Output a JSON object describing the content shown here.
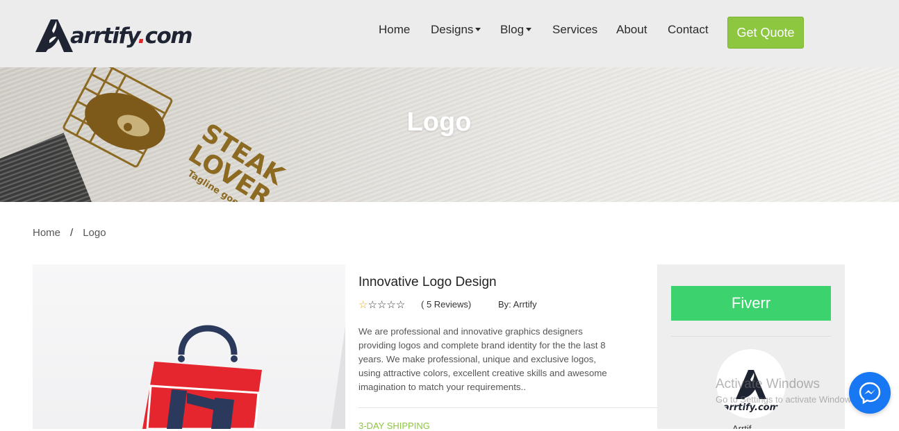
{
  "brand": {
    "name_main": "arrtify",
    "name_dot": ".",
    "name_tld": "com",
    "logo_icon": "arrtify-logo-icon"
  },
  "nav": {
    "items": [
      {
        "label": "Home",
        "has_dropdown": false
      },
      {
        "label": "Designs",
        "has_dropdown": true
      },
      {
        "label": "Blog",
        "has_dropdown": true
      },
      {
        "label": "Services",
        "has_dropdown": false
      },
      {
        "label": "About",
        "has_dropdown": false
      },
      {
        "label": "Contact",
        "has_dropdown": false
      }
    ],
    "cta_label": "Get Quote"
  },
  "hero": {
    "title": "Logo",
    "mockup_line1": "STEAK",
    "mockup_line2": "LOVER",
    "mockup_tagline": "Tagline goes h"
  },
  "breadcrumb": {
    "home": "Home",
    "separator": "/",
    "current": "Logo"
  },
  "product": {
    "title": "Innovative Logo Design",
    "rating": 0.5,
    "rating_max": 5,
    "reviews": "( 5 Reviews)",
    "by": "By: Arrtify",
    "description": "We are professional and innovative graphics designers providing logos and complete brand identity for the the last 8 years. We make professional, unique and exclusive logos, using attractive colors, excellent creative skills and awesome imagination to match your requirements..",
    "shipping": "3-DAY SHIPPING"
  },
  "sidebar": {
    "fiverr_label": "Fiverr",
    "seller_logo_text": "arrtify.com",
    "seller_name": "Arrtif"
  },
  "watermark": {
    "line1": "Activate Windows",
    "line2": "Go to Settings to activate Windows."
  },
  "colors": {
    "accent_green": "#8dc63f",
    "fiverr_green": "#3cd36e",
    "brand_navy": "#1f2433",
    "brand_red": "#e0242e",
    "messenger_blue": "#1877f2"
  },
  "icons": {
    "stars": "star-icon",
    "messenger": "messenger-icon",
    "caret": "caret-down-icon"
  }
}
